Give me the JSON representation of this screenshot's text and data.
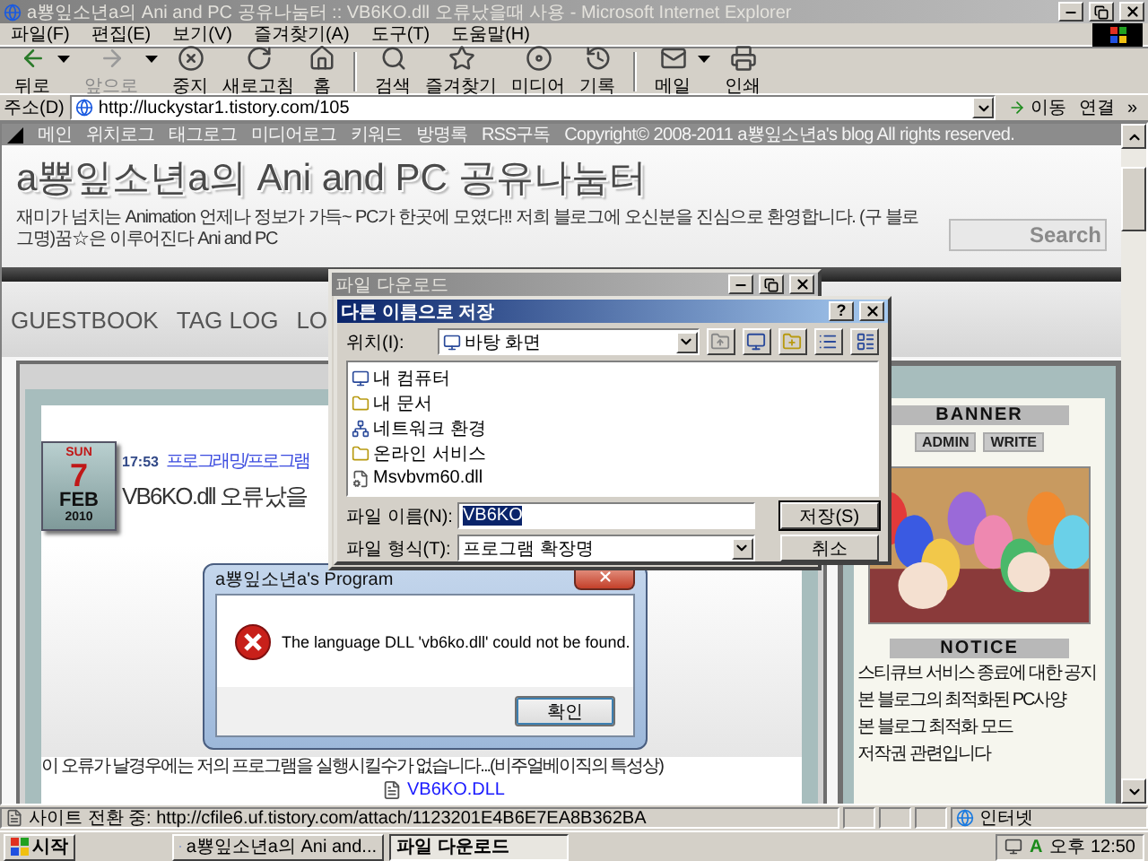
{
  "window": {
    "title": "a뿅잎소년a의 Ani and PC 공유나눔터 :: VB6KO.dll 오류났을때 사용 - Microsoft Internet Explorer",
    "active": false
  },
  "menu": [
    "파일(F)",
    "편집(E)",
    "보기(V)",
    "즐겨찾기(A)",
    "도구(T)",
    "도움말(H)"
  ],
  "toolbar": [
    [
      {
        "label": "뒤로",
        "kind": "back",
        "disabled": false,
        "dropdown": true
      },
      {
        "label": "앞으로",
        "kind": "forward",
        "disabled": true,
        "dropdown": true
      },
      {
        "label": "중지",
        "kind": "stop",
        "disabled": false,
        "dropdown": false
      },
      {
        "label": "새로고침",
        "kind": "refresh",
        "disabled": false,
        "dropdown": false
      },
      {
        "label": "홈",
        "kind": "home",
        "disabled": false,
        "dropdown": false
      }
    ],
    [
      {
        "label": "검색",
        "kind": "search",
        "disabled": false,
        "dropdown": false
      },
      {
        "label": "즐겨찾기",
        "kind": "favorites",
        "disabled": false,
        "dropdown": false
      },
      {
        "label": "미디어",
        "kind": "media",
        "disabled": false,
        "dropdown": false
      },
      {
        "label": "기록",
        "kind": "history",
        "disabled": false,
        "dropdown": false
      }
    ],
    [
      {
        "label": "메일",
        "kind": "mail",
        "disabled": false,
        "dropdown": true
      },
      {
        "label": "인쇄",
        "kind": "print",
        "disabled": false,
        "dropdown": false
      }
    ]
  ],
  "address": {
    "label": "주소(D)",
    "value": "http://luckystar1.tistory.com/105",
    "go": "이동",
    "links": "연결",
    "more": "»"
  },
  "page": {
    "nav_links": [
      "메인",
      "위치로그",
      "태그로그",
      "미디어로그",
      "키워드",
      "방명록",
      "RSS구독"
    ],
    "copyright": "Copyright© 2008-2011 a뿅잎소년a's blog All rights reserved.",
    "blog_title": "a뿅잎소년a의 Ani and PC 공유나눔터",
    "tagline": "재미가 넘치는 Animation 언제나 정보가 가득~ PC가 한곳에 모였다!! 저희 블로그에 오신분을 진심으로 환영합니다. (구 블로그명)꿈☆은 이루어진다 Ani and PC",
    "search_placeholder": "Search",
    "menu": [
      "GUESTBOOK",
      "TAG LOG",
      "LO"
    ],
    "post": {
      "day_name": "SUN",
      "day": "7",
      "month": "FEB",
      "year": "2010",
      "time": "17:53",
      "category": "프로그래밍/프로그램",
      "title": "VB6KO.dll 오류났을",
      "body": "이 오류가 날경우에는 저의 프로그램을 실행시킬수가 없습니다...(비주얼베이직의 특성상)",
      "attachment": "VB6KO.DLL"
    },
    "sidebar": {
      "banner_heading": "BANNER",
      "admin_buttons": [
        "ADMIN",
        "WRITE"
      ],
      "banner": {
        "kind": "picture"
      },
      "notice_heading": "NOTICE",
      "notices": [
        "스티큐브 서비스 종료에 대한 공지",
        "본 블로그의 최적화된 PC사양",
        "본 블로그 최적화 모드",
        "저작권 관련입니다"
      ]
    }
  },
  "status_bar": {
    "text": "사이트 전환 중: http://cfile6.uf.tistory.com/attach/1123201E4B6E7EA8B362BA",
    "zone": "인터넷"
  },
  "error_dialog": {
    "title": "a뿅잎소년a's Program",
    "message": "The language DLL 'vb6ko.dll' could not be found.",
    "button": "확인"
  },
  "download_window": {
    "title": "파일 다운로드",
    "active": false
  },
  "save_dialog": {
    "title": "다른 이름으로 저장",
    "active": true,
    "help": "?",
    "location_label": "위치(I):",
    "location": "바탕 화면",
    "items": [
      {
        "name": "내 컴퓨터",
        "kind": "computer"
      },
      {
        "name": "내 문서",
        "kind": "folder"
      },
      {
        "name": "네트워크 환경",
        "kind": "network"
      },
      {
        "name": "온라인 서비스",
        "kind": "folder"
      },
      {
        "name": "Msvbvm60.dll",
        "kind": "file"
      }
    ],
    "filename_label": "파일 이름(N):",
    "filename": {
      "value": "VB6KO",
      "highlighted": true
    },
    "filetype_label": "파일 형식(T):",
    "filetype": "프로그램 확장명",
    "buttons": [
      "저장(S)",
      "취소"
    ]
  },
  "taskbar": {
    "start": "시작",
    "tasks": [
      {
        "label": "a뿅잎소년a의 Ani and...",
        "selected": false
      },
      {
        "label": "파일 다운로드",
        "selected": true
      }
    ],
    "ime": "A",
    "clock": "오후 12:50"
  }
}
